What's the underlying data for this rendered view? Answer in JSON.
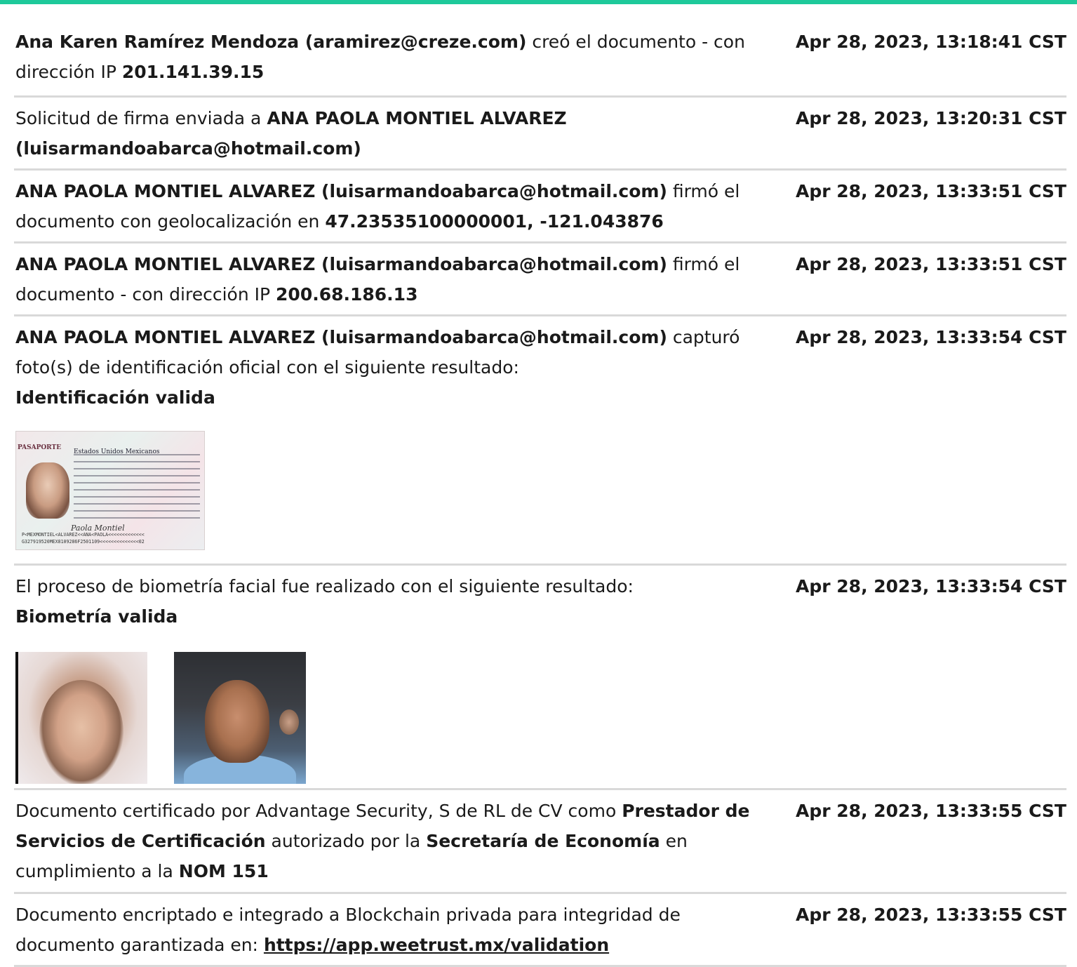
{
  "entries": [
    {
      "parts": [
        {
          "t": "Ana Karen Ramírez Mendoza (aramirez@creze.com)",
          "b": true
        },
        {
          "t": " creó el documento - con dirección IP "
        },
        {
          "t": "201.141.39.15",
          "b": true
        }
      ],
      "time": "Apr 28, 2023, 13:18:41 CST"
    },
    {
      "parts": [
        {
          "t": "Solicitud de firma enviada a "
        },
        {
          "t": "ANA PAOLA MONTIEL ALVAREZ (luisarmandoabarca@hotmail.com)",
          "b": true
        }
      ],
      "time": "Apr 28, 2023, 13:20:31 CST"
    },
    {
      "parts": [
        {
          "t": "ANA PAOLA MONTIEL ALVAREZ (luisarmandoabarca@hotmail.com)",
          "b": true
        },
        {
          "t": " firmó el documento con geolocalización en "
        },
        {
          "t": "47.23535100000001, -121.043876",
          "b": true
        }
      ],
      "time": "Apr 28, 2023, 13:33:51 CST"
    },
    {
      "parts": [
        {
          "t": "ANA PAOLA MONTIEL ALVAREZ (luisarmandoabarca@hotmail.com)",
          "b": true
        },
        {
          "t": " firmó el documento - con dirección IP "
        },
        {
          "t": "200.68.186.13",
          "b": true
        }
      ],
      "time": "Apr 28, 2023, 13:33:51 CST"
    },
    {
      "parts": [
        {
          "t": "ANA PAOLA MONTIEL ALVAREZ (luisarmandoabarca@hotmail.com)",
          "b": true
        },
        {
          "t": " capturó foto(s) de identificación oficial con el siguiente resultado: "
        },
        {
          "t": "Identificación valida",
          "b": true,
          "br": true
        }
      ],
      "time": "Apr 28, 2023, 13:33:54 CST",
      "passport": {
        "header": "PASAPORTE",
        "country": "Estados Unidos Mexicanos",
        "signature": "Paola Montiel",
        "mrz1": "P<MEXMONTIEL<ALVAREZ<<ANA<PAOLA<<<<<<<<<<<<<",
        "mrz2": "G327919520MEX8109286F2501109<<<<<<<<<<<<<<02"
      }
    },
    {
      "parts": [
        {
          "t": "El proceso de biometría facial fue realizado con el siguiente resultado: "
        },
        {
          "t": "Biometría valida",
          "b": true,
          "br": true
        }
      ],
      "time": "Apr 28, 2023, 13:33:54 CST",
      "faces": true
    },
    {
      "parts": [
        {
          "t": "Documento certificado por Advantage Security, S de RL de CV como "
        },
        {
          "t": "Prestador de Servicios de Certificación",
          "b": true
        },
        {
          "t": " autorizado por la "
        },
        {
          "t": "Secretaría de Economía",
          "b": true
        },
        {
          "t": " en cumplimiento a la "
        },
        {
          "t": "NOM 151",
          "b": true
        }
      ],
      "time": "Apr 28, 2023, 13:33:55 CST"
    },
    {
      "parts": [
        {
          "t": "Documento encriptado e integrado a Blockchain privada para integridad de documento garantizada en: "
        },
        {
          "t": "https://app.weetrust.mx/validation",
          "b": true,
          "link": true
        }
      ],
      "time": "Apr 28, 2023, 13:33:55 CST"
    }
  ],
  "colors": {
    "accent": "#1ec99a",
    "divider": "#d9d9d9"
  }
}
